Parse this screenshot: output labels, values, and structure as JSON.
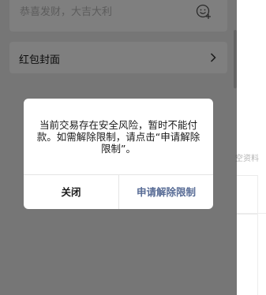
{
  "blessing_field": {
    "placeholder": "恭喜发财，大吉大利",
    "emoji_icon": "emoji-add-icon"
  },
  "cover_row": {
    "label": "红包封面",
    "icon": "chevron-right-icon"
  },
  "background_right": {
    "partial_text": "空资料"
  },
  "dialog": {
    "message": "当前交易存在安全风险，暂时不能付款。如需解除限制，请点击“申请解除限制”。",
    "close_label": "关闭",
    "unlock_label": "申请解除限制",
    "accent_color": "#576b95"
  }
}
